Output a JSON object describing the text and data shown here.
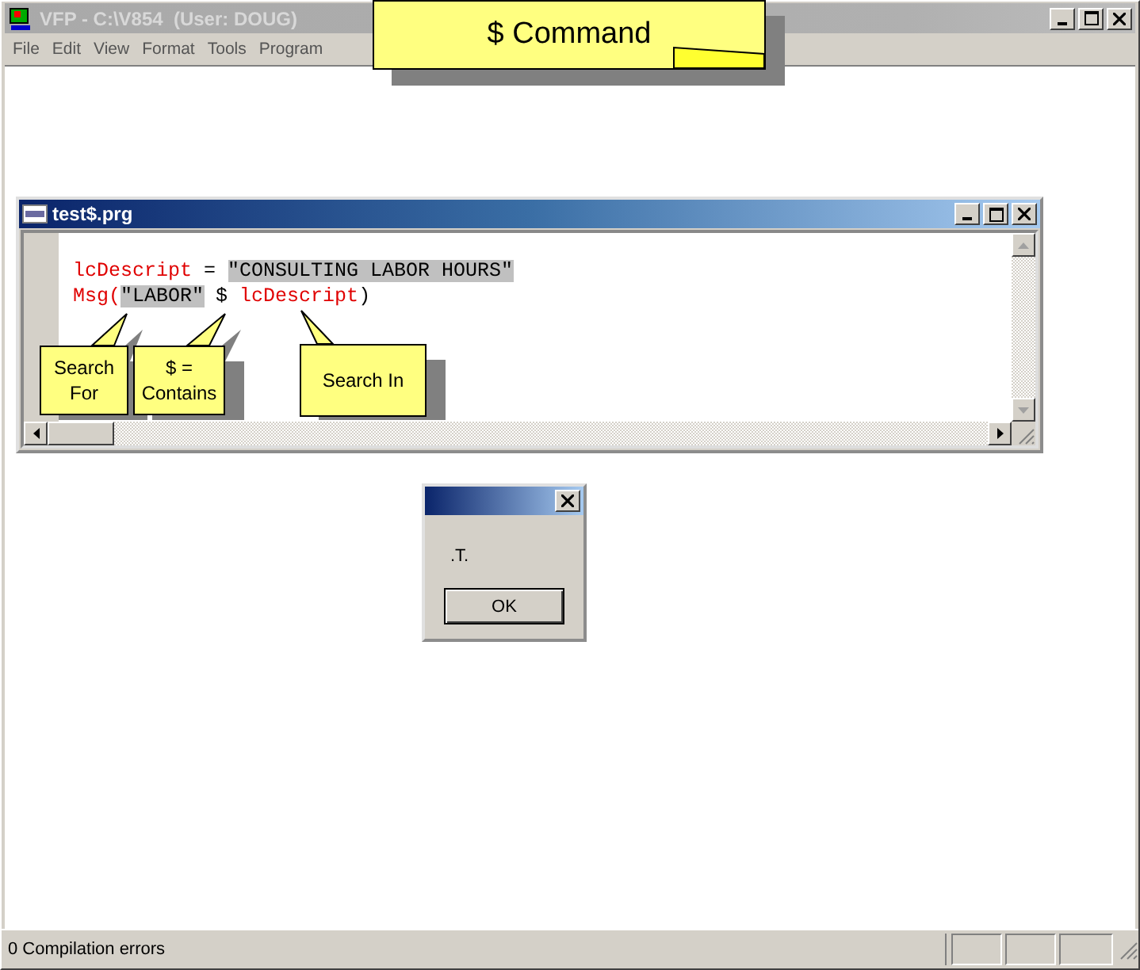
{
  "window": {
    "title": "VFP - C:\\V854  (User: DOUG)"
  },
  "menu": [
    "File",
    "Edit",
    "View",
    "Format",
    "Tools",
    "Program"
  ],
  "editor": {
    "title": "test$.prg",
    "lines": [
      [
        {
          "text": "lcDescript",
          "kind": "keyword"
        },
        {
          "text": " = ",
          "kind": "plain"
        },
        {
          "text": "\"CONSULTING LABOR HOURS\"",
          "kind": "string"
        }
      ],
      [
        {
          "text": "Msg(",
          "kind": "keyword"
        },
        {
          "text": "\"LABOR\"",
          "kind": "string"
        },
        {
          "text": " $ ",
          "kind": "plain"
        },
        {
          "text": "lcDescript",
          "kind": "keyword"
        },
        {
          "text": ")",
          "kind": "plain"
        }
      ]
    ]
  },
  "dialog": {
    "message": ".T.",
    "button": "OK"
  },
  "callouts": [
    {
      "text": "$ Command",
      "kind": "banner"
    },
    {
      "text": "Search For",
      "kind": "pointer"
    },
    {
      "text": "$ = Contains",
      "kind": "pointer"
    },
    {
      "text": "Search In",
      "kind": "pointer"
    }
  ],
  "status_bar": {
    "text": "0 Compilation errors"
  }
}
